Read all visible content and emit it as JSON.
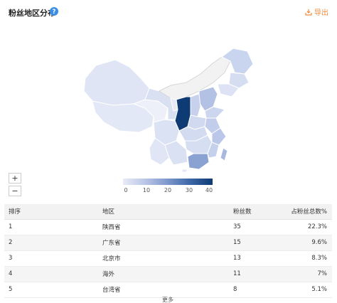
{
  "header": {
    "title": "粉丝地区分布",
    "export_label": "导出"
  },
  "map": {
    "zoom_in": "+",
    "zoom_out": "−",
    "scale_ticks": [
      "0",
      "10",
      "20",
      "30",
      "40"
    ],
    "scale_colors": [
      "#e8ecf7",
      "#0e3b73"
    ]
  },
  "table": {
    "headers": [
      "排序",
      "地区",
      "粉丝数",
      "占粉丝总数%"
    ],
    "rows": [
      {
        "rank": "1",
        "region": "陕西省",
        "fans": "35",
        "pct": "22.3%"
      },
      {
        "rank": "2",
        "region": "广东省",
        "fans": "15",
        "pct": "9.6%"
      },
      {
        "rank": "3",
        "region": "北京市",
        "fans": "13",
        "pct": "8.3%"
      },
      {
        "rank": "4",
        "region": "海外",
        "fans": "11",
        "pct": "7%"
      },
      {
        "rank": "5",
        "region": "台湾省",
        "fans": "8",
        "pct": "5.1%"
      }
    ]
  },
  "footer": {
    "more_label": "更多"
  }
}
